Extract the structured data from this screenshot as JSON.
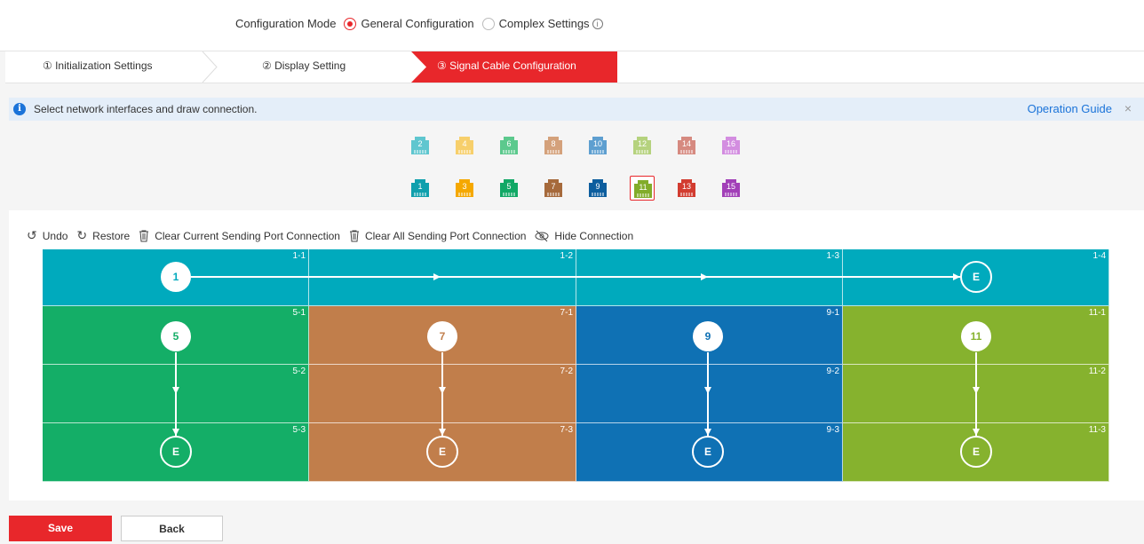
{
  "config_mode": {
    "label": "Configuration Mode",
    "options": [
      {
        "label": "General Configuration",
        "selected": true
      },
      {
        "label": "Complex Settings",
        "selected": false
      }
    ],
    "info_icon": "info-circle-icon"
  },
  "steps": [
    {
      "label": "① Initialization Settings",
      "active": false
    },
    {
      "label": "② Display Setting",
      "active": false
    },
    {
      "label": "③ Signal Cable Configuration",
      "active": true
    }
  ],
  "info_bar": {
    "message": "Select network interfaces and draw connection.",
    "guide_link": "Operation Guide",
    "close": "×"
  },
  "ports": {
    "top_row": [
      {
        "num": "2",
        "color": "#5fc6cf"
      },
      {
        "num": "4",
        "color": "#f7cf6b"
      },
      {
        "num": "6",
        "color": "#5cc98d"
      },
      {
        "num": "8",
        "color": "#d4a17b"
      },
      {
        "num": "10",
        "color": "#5e9fd0"
      },
      {
        "num": "12",
        "color": "#b5d27e"
      },
      {
        "num": "14",
        "color": "#d68a80"
      },
      {
        "num": "16",
        "color": "#d38de0"
      }
    ],
    "bottom_row": [
      {
        "num": "1",
        "color": "#10a0ad"
      },
      {
        "num": "3",
        "color": "#f5a800"
      },
      {
        "num": "5",
        "color": "#12a866"
      },
      {
        "num": "7",
        "color": "#a66a3c"
      },
      {
        "num": "9",
        "color": "#0d5e9e"
      },
      {
        "num": "11",
        "color": "#82ac2a",
        "selected": true
      },
      {
        "num": "13",
        "color": "#d23c30"
      },
      {
        "num": "15",
        "color": "#a240b8"
      }
    ]
  },
  "toolbar": {
    "undo": "Undo",
    "restore": "Restore",
    "clear_current": "Clear Current Sending Port Connection",
    "clear_all": "Clear All Sending Port Connection",
    "hide": "Hide Connection"
  },
  "screens": {
    "rows": [
      {
        "color": "#00aabd",
        "cells": [
          "1-1",
          "1-2",
          "1-3",
          "1-4"
        ]
      },
      {
        "colors": [
          "#14ae67",
          "#c17e4b",
          "#0f71b4",
          "#86b22e"
        ],
        "cells": [
          "5-1",
          "7-1",
          "9-1",
          "11-1"
        ]
      },
      {
        "colors": [
          "#14ae67",
          "#c17e4b",
          "#0f71b4",
          "#86b22e"
        ],
        "cells": [
          "5-2",
          "7-2",
          "9-2",
          "11-2"
        ]
      },
      {
        "colors": [
          "#14ae67",
          "#c17e4b",
          "#0f71b4",
          "#86b22e"
        ],
        "cells": [
          "5-3",
          "7-3",
          "9-3",
          "11-3"
        ]
      }
    ],
    "start_nodes": [
      "1",
      "5",
      "7",
      "9",
      "11"
    ],
    "end_node": "E"
  },
  "buttons": {
    "save": "Save",
    "back": "Back"
  }
}
